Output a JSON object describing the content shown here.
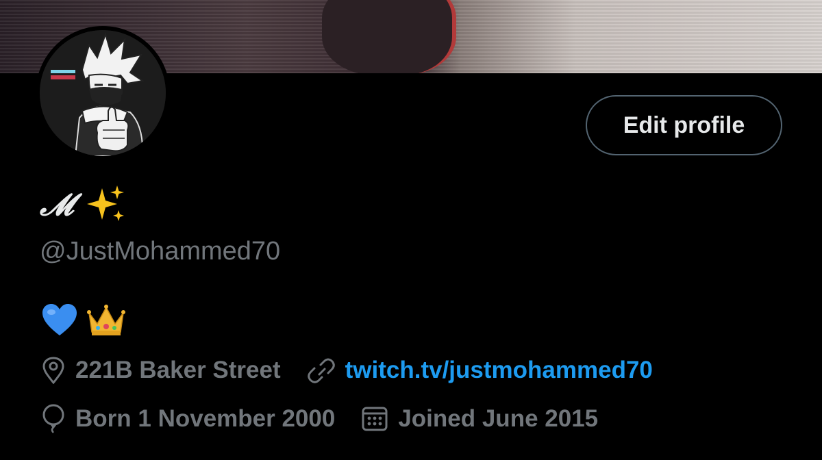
{
  "profile": {
    "display_name": "𝓜",
    "handle": "@JustMohammed70",
    "bio_icons": [
      "blue-heart-icon",
      "crown-icon"
    ],
    "location": "221B Baker Street",
    "website": "twitch.tv/justmohammed70",
    "birthday": "Born 1 November 2000",
    "joined": "Joined June 2015"
  },
  "actions": {
    "edit_profile_label": "Edit profile"
  },
  "colors": {
    "background": "#000000",
    "primary_text": "#e7e9ea",
    "secondary_text": "#71767b",
    "link": "#1d9bf0",
    "button_border": "#536471"
  }
}
